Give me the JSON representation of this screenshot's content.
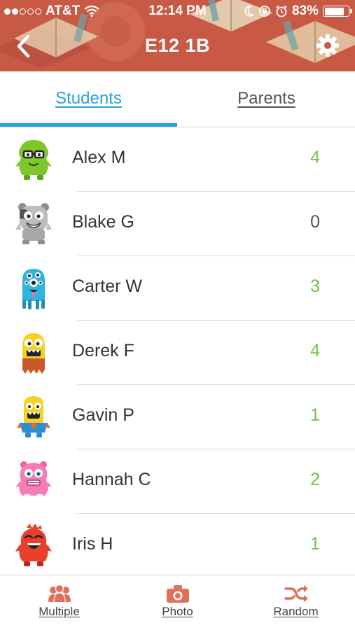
{
  "status_bar": {
    "carrier": "AT&T",
    "time": "12:14 PM",
    "battery": "83%",
    "battery_level": 0.83,
    "signal_dots_filled": 2,
    "signal_dots_total": 5
  },
  "nav": {
    "title": "E12 1B",
    "back_icon": "chevron-left-icon",
    "settings_icon": "gear-icon"
  },
  "tabs": [
    {
      "label": "Students",
      "active": true
    },
    {
      "label": "Parents",
      "active": false
    }
  ],
  "students": [
    {
      "name": "Alex M",
      "points": "4",
      "avatar": "green-monster-icon"
    },
    {
      "name": "Blake G",
      "points": "0",
      "avatar": "gray-monster-icon"
    },
    {
      "name": "Carter W",
      "points": "3",
      "avatar": "blue-monster-icon"
    },
    {
      "name": "Derek F",
      "points": "4",
      "avatar": "yellow-monster-icon"
    },
    {
      "name": "Gavin P",
      "points": "1",
      "avatar": "yellow-blue-monster-icon"
    },
    {
      "name": "Hannah C",
      "points": "2",
      "avatar": "pink-monster-icon"
    },
    {
      "name": "Iris H",
      "points": "1",
      "avatar": "red-monster-icon"
    }
  ],
  "bottom_bar": {
    "multiple": "Multiple",
    "photo": "Photo",
    "random": "Random"
  },
  "colors": {
    "header": "#c85a45",
    "accent_blue": "#2a9fe0",
    "points_green": "#7cc043",
    "icon_orange": "#e0705a"
  }
}
